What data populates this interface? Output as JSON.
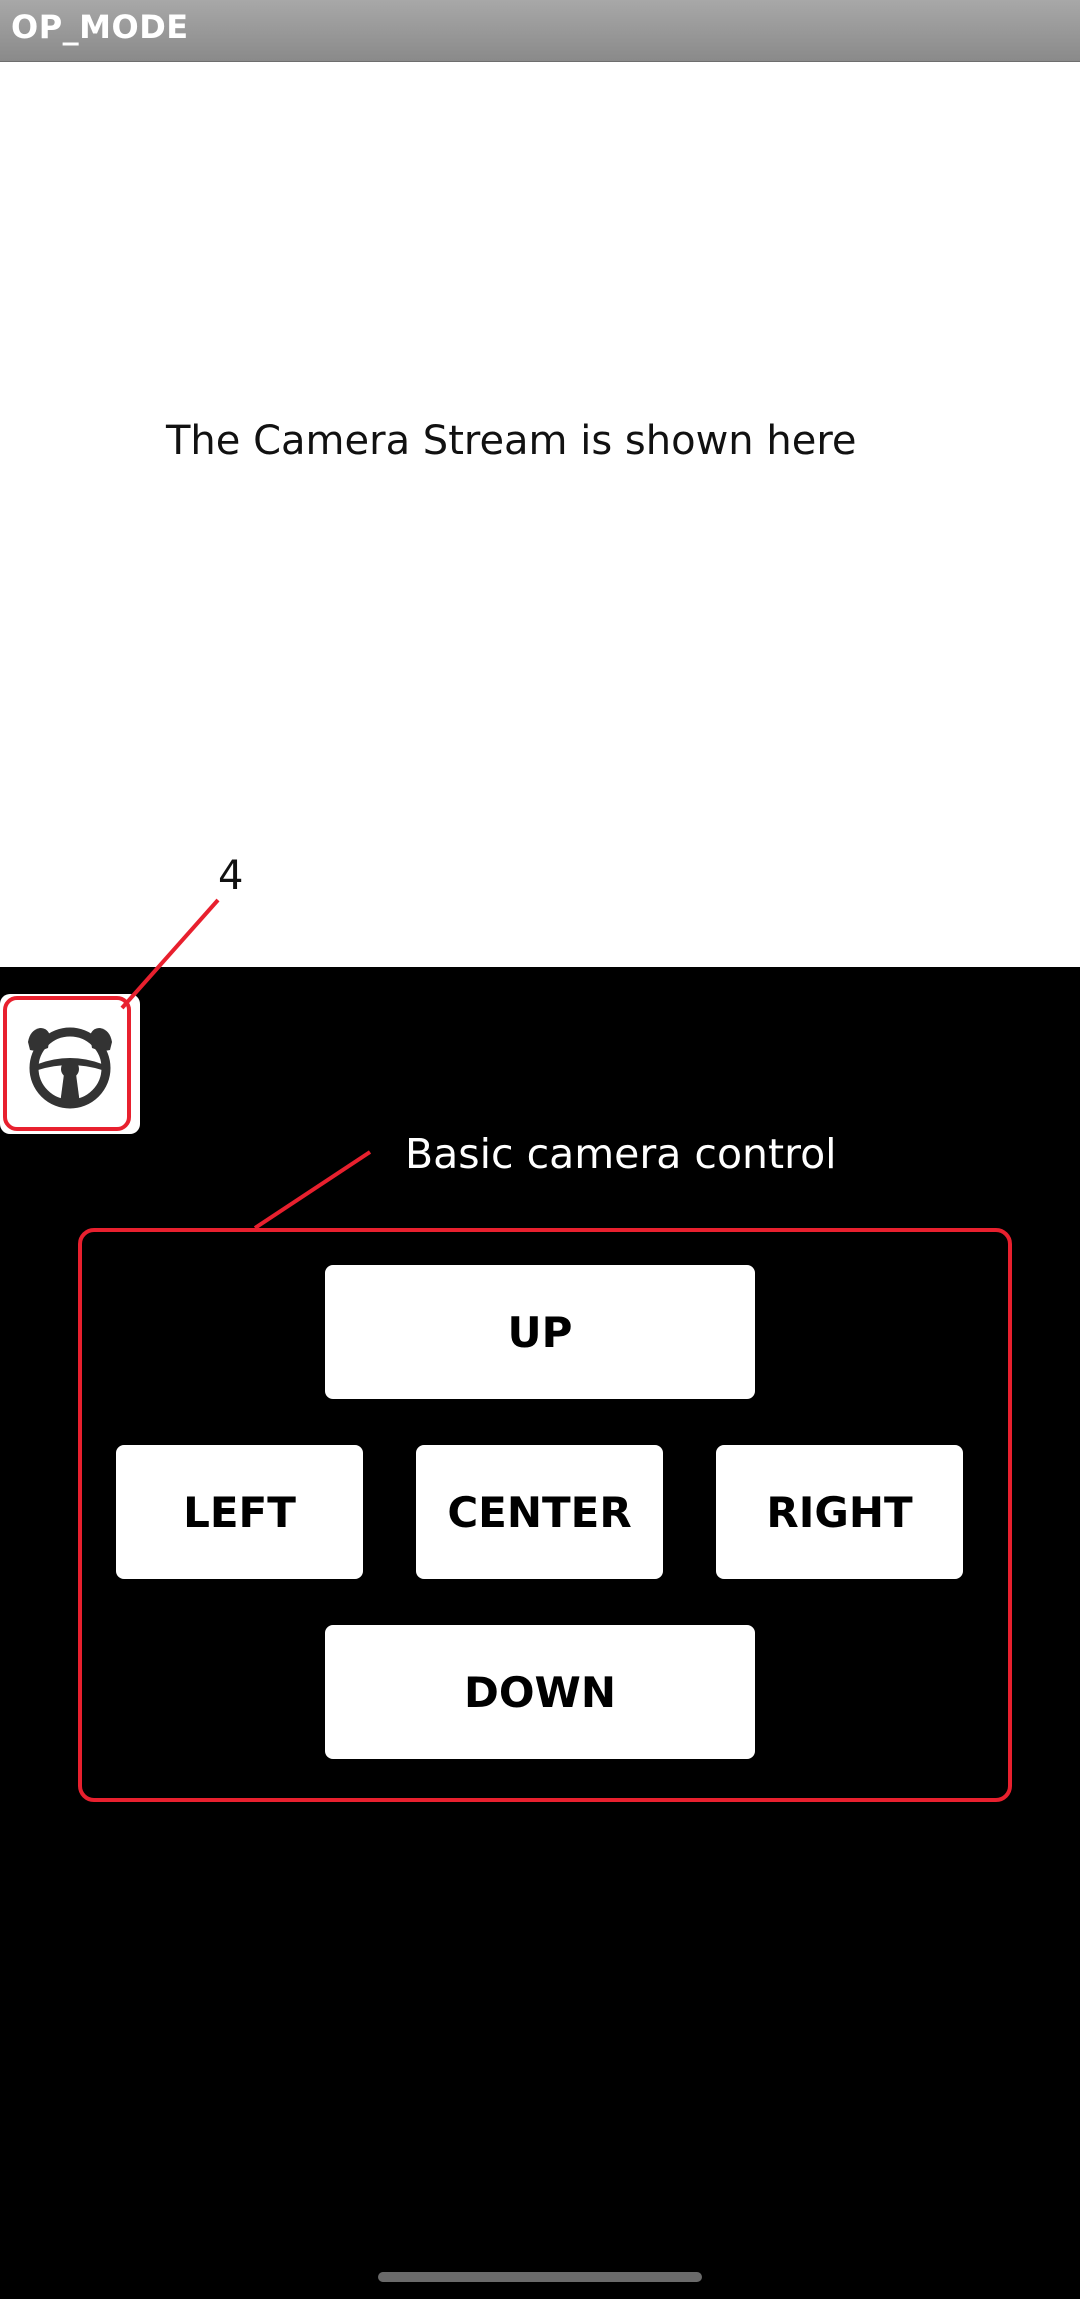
{
  "app": {
    "title": "OP_MODE"
  },
  "camera": {
    "placeholder_text": "The Camera Stream is shown here"
  },
  "annotations": {
    "mode_callout_number": "4",
    "control_callout_label": "Basic camera control",
    "highlight_color": "#e8202e"
  },
  "mode_button": {
    "icon": "steering-wheel-icon"
  },
  "controls": {
    "up_label": "UP",
    "left_label": "LEFT",
    "center_label": "CENTER",
    "right_label": "RIGHT",
    "down_label": "DOWN"
  }
}
